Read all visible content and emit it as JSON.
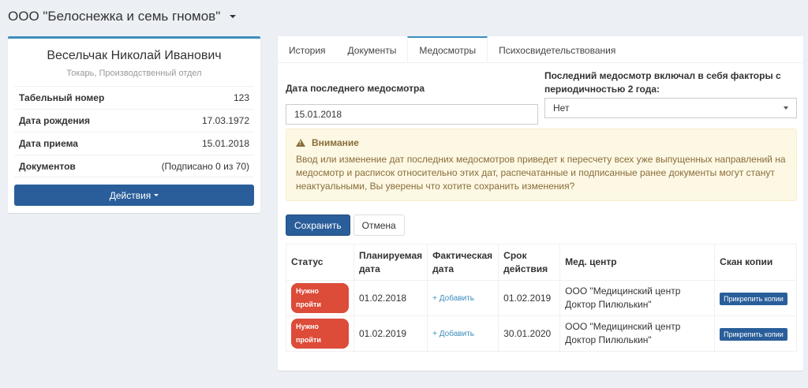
{
  "org": {
    "name": "ООО \"Белоснежка и семь гномов\""
  },
  "profile": {
    "name": "Весельчак Николай Иванович",
    "position": "Токарь, Производственный отдел",
    "rows": [
      {
        "label": "Табельный номер",
        "value": "123"
      },
      {
        "label": "Дата рождения",
        "value": "17.03.1972"
      },
      {
        "label": "Дата приема",
        "value": "15.01.2018"
      },
      {
        "label": "Документов",
        "value": "(Подписано 0 из 70)"
      }
    ],
    "actions_label": "Действия"
  },
  "tabs": [
    {
      "label": "История"
    },
    {
      "label": "Документы"
    },
    {
      "label": "Медосмотры"
    },
    {
      "label": "Психосвидетельствования"
    }
  ],
  "form": {
    "last_exam_label": "Дата последнего медосмотра",
    "last_exam_value": "15.01.2018",
    "factors_label": "Последний медосмотр включал в себя факторы с периодичностью 2 года:",
    "factors_value": "Нет"
  },
  "alert": {
    "title": "Внимание",
    "text": "Ввод или изменение дат последних медосмотров приведет к пересчету всех уже выпущенных направлений на медосмотр и расписок относительно этих дат, распечатанные и подписанные ранее документы могут станут неактуальными, Вы уверены что хотите сохранить изменения?"
  },
  "buttons": {
    "save": "Сохранить",
    "cancel": "Отмена"
  },
  "table": {
    "headers": [
      "Статус",
      "Планируемая дата",
      "Фактическая дата",
      "Срок действия",
      "Мед. центр",
      "Скан копии"
    ],
    "rows": [
      {
        "status": "Нужно пройти",
        "planned": "01.02.2018",
        "actual": "+ Добавить",
        "valid": "01.02.2019",
        "center": "ООО \"Медицинский центр Доктор Пилюлькин\"",
        "scan": "Прикрепить копии"
      },
      {
        "status": "Нужно пройти",
        "planned": "01.02.2019",
        "actual": "+ Добавить",
        "valid": "30.01.2020",
        "center": "ООО \"Медицинский центр Доктор Пилюлькин\"",
        "scan": "Прикрепить копии"
      }
    ]
  },
  "colors": {
    "primary": "#2a5e9a",
    "accent": "#3c8dbc",
    "danger": "#dd4b39",
    "warning_bg": "#fcf8e3"
  }
}
